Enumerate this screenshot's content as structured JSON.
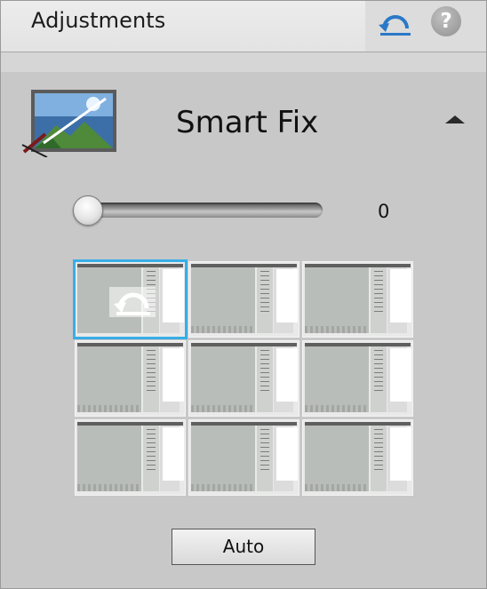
{
  "header": {
    "title": "Adjustments",
    "undo_icon": "undo-arrow-icon",
    "help_icon": "help-icon",
    "help_label": "?"
  },
  "section": {
    "title": "Smart Fix",
    "icon": "smart-fix-icon",
    "collapse_icon": "collapse-triangle-icon"
  },
  "slider": {
    "value": "0",
    "level": 0
  },
  "thumbnails": {
    "rows": 3,
    "cols": 3,
    "selected_index": 0,
    "selected_overlay_icon": "reset-arrow-icon"
  },
  "auto_button": {
    "label": "Auto"
  },
  "colors": {
    "selection": "#38aee6",
    "undo_arrow": "#2a79c7"
  }
}
